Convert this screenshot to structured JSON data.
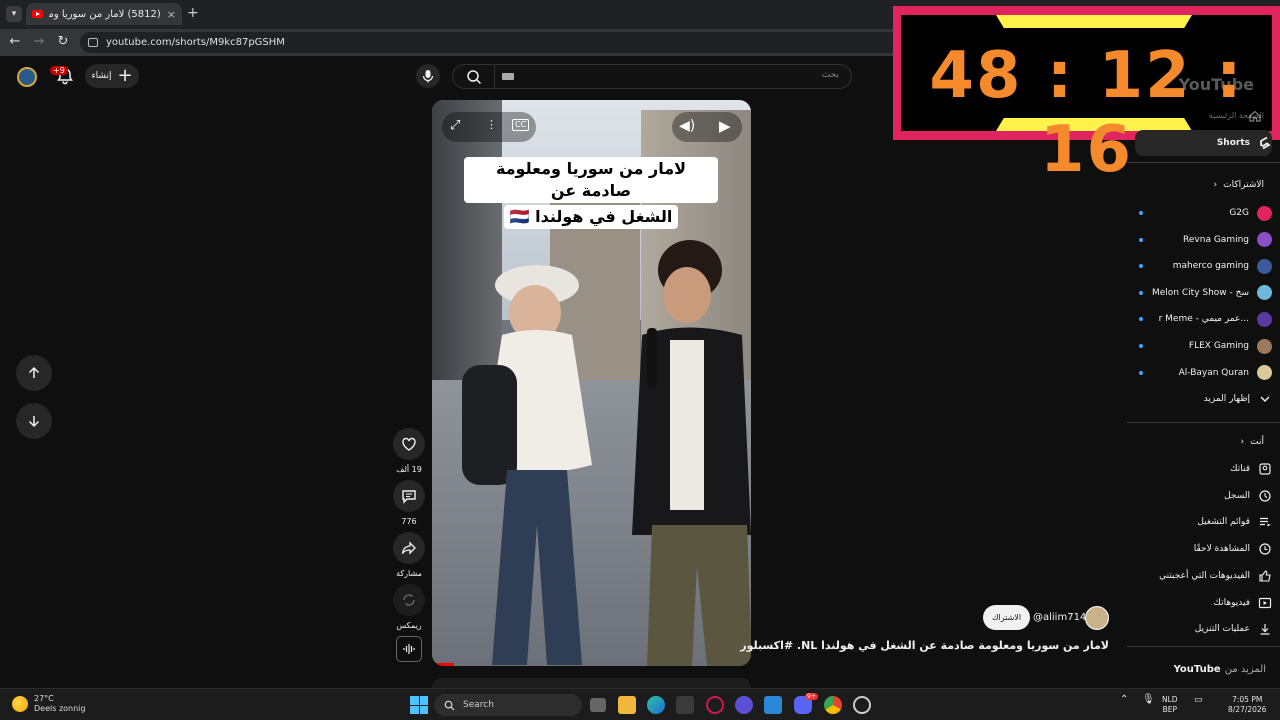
{
  "browser": {
    "tab_title": "(5812) لامار من سوريا ومعلومة صادمة عن ...",
    "new_tab": "+",
    "close": "×",
    "url": "youtube.com/shorts/M9kc87pGSHM"
  },
  "timer": {
    "display": "48 : 12 : 16"
  },
  "header": {
    "create_label": "إنشاء",
    "notifications_badge": "+9",
    "search_placeholder": "بحث"
  },
  "video": {
    "caption_line1": "لامار من سوريا ومعلومة صادمة عن",
    "caption_line2": "الشغل في هولندا 🇳🇱"
  },
  "actions": {
    "likes": "19 ألف",
    "comments": "776",
    "share": "مشاركة",
    "remix": "ريمكس"
  },
  "channel": {
    "handle": "@aliim714",
    "subscribe": "الاشتراك",
    "title": "لامار من سوريا ومعلومة صادمة عن الشغل في هولندا NL. #اكسبلور"
  },
  "sidebar": {
    "logo_ghost": "YouTube",
    "home_ghost": "الصفحة الرئيسية",
    "shorts": "Shorts",
    "subscriptions_header": "الاشتراكات",
    "channels": [
      {
        "name": "G2G",
        "color": "#e0245e"
      },
      {
        "name": "Revna Gaming",
        "color": "#8a4fc4"
      },
      {
        "name": "maherco gaming",
        "color": "#3a5a9a"
      },
      {
        "name": "Melon City Show - سخ",
        "color": "#6fb8d8"
      },
      {
        "name": "r Meme - عمر ميمي...",
        "color": "#5a3aa0"
      },
      {
        "name": "FLEX Gaming",
        "color": "#9a7a5a"
      },
      {
        "name": "Al-Bayan Quran",
        "color": "#d8c89a"
      }
    ],
    "show_more": "إظهار المزيد",
    "you_header": "أنت",
    "you_items": [
      {
        "label": "قناتك",
        "icon": "channel-icon"
      },
      {
        "label": "السجل",
        "icon": "history-icon"
      },
      {
        "label": "قوائم التشغيل",
        "icon": "playlists-icon"
      },
      {
        "label": "المشاهدة لاحقًا",
        "icon": "watch-later-icon"
      },
      {
        "label": "الفيديوهات التي أعجبتني",
        "icon": "liked-icon"
      },
      {
        "label": "فيديوهاتك",
        "icon": "your-videos-icon"
      },
      {
        "label": "عمليات التنزيل",
        "icon": "downloads-icon"
      }
    ],
    "more_from": "المزيد من",
    "more_from_brand": "YouTube"
  },
  "taskbar": {
    "temp": "27°C",
    "weather": "Deels zonnig",
    "search": "Search",
    "lang1": "NLD",
    "lang2": "BEP",
    "time": "7:05 PM",
    "date": "8/27/2026",
    "discord_badge": "9+"
  }
}
